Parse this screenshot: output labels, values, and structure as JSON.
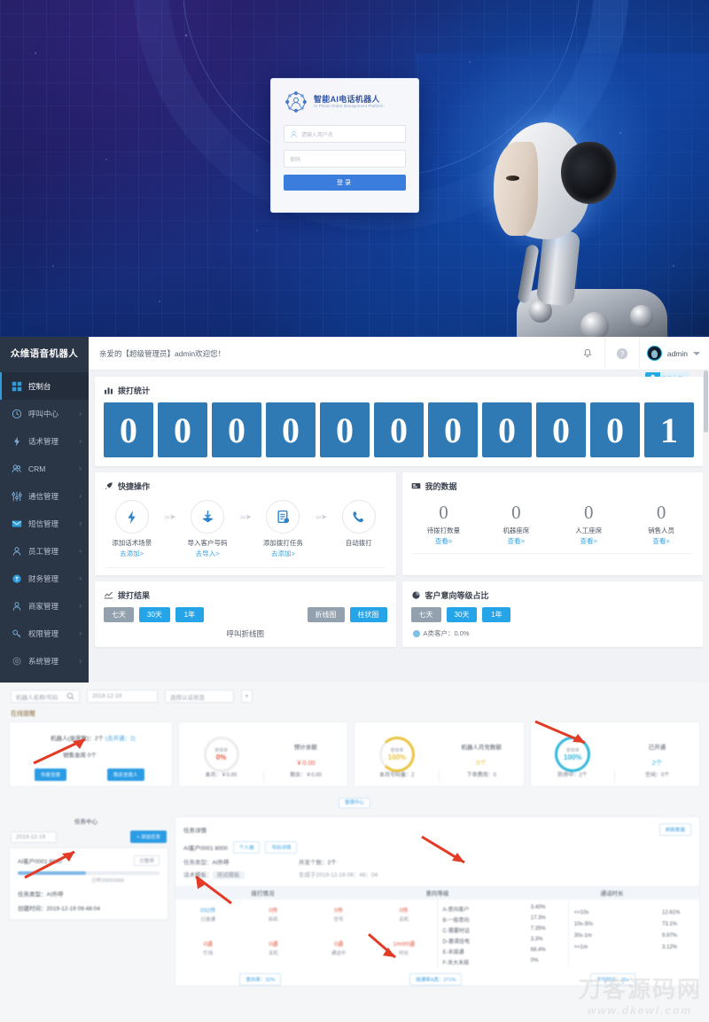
{
  "login": {
    "title_cn": "智能AI电话机器人",
    "title_en": "AI Phone Robot Management Platform",
    "username_placeholder": "请输入用户名",
    "password_placeholder": "密码",
    "submit_label": "登录"
  },
  "topbar": {
    "brand": "众维语音机器人",
    "welcome": "亲爱的【超级管理员】admin欢迎您！",
    "user": "admin",
    "upload_badge": "协议上传"
  },
  "sidebar": {
    "items": [
      {
        "label": "控制台",
        "icon": "dashboard-icon",
        "active": true,
        "arrow": ""
      },
      {
        "label": "呼叫中心",
        "icon": "clock-icon",
        "active": false,
        "arrow": "›"
      },
      {
        "label": "话术管理",
        "icon": "bolt-icon",
        "active": false,
        "arrow": "›"
      },
      {
        "label": "CRM",
        "icon": "users-icon",
        "active": false,
        "arrow": "›"
      },
      {
        "label": "通信管理",
        "icon": "sliders-icon",
        "active": false,
        "arrow": "›"
      },
      {
        "label": "短信管理",
        "icon": "mail-icon",
        "active": false,
        "arrow": "›"
      },
      {
        "label": "员工管理",
        "icon": "user-icon",
        "active": false,
        "arrow": "›"
      },
      {
        "label": "财务管理",
        "icon": "coin-icon",
        "active": false,
        "arrow": "›"
      },
      {
        "label": "商家管理",
        "icon": "user-icon",
        "active": false,
        "arrow": "›"
      },
      {
        "label": "权限管理",
        "icon": "key-icon",
        "active": false,
        "arrow": "›"
      },
      {
        "label": "系统管理",
        "icon": "gear-icon",
        "active": false,
        "arrow": "›"
      }
    ]
  },
  "call_stats": {
    "title": "拨打统计",
    "icon": "bar-chart-icon",
    "digits": [
      "0",
      "0",
      "0",
      "0",
      "0",
      "0",
      "0",
      "0",
      "0",
      "0",
      "1"
    ]
  },
  "quick_ops": {
    "title": "快捷操作",
    "icon": "rocket-icon",
    "steps": [
      {
        "icon": "bolt-icon",
        "label": "添加话术场景",
        "link": "去添加>"
      },
      {
        "icon": "import-icon",
        "label": "导入客户号码",
        "link": "去导入>"
      },
      {
        "icon": "doc-add-icon",
        "label": "添加拨打任务",
        "link": "去添加>"
      },
      {
        "icon": "phone-icon",
        "label": "自动拨打",
        "link": ""
      }
    ],
    "connector": "›››➤"
  },
  "my_data": {
    "title": "我的数据",
    "icon": "monitor-icon",
    "items": [
      {
        "value": "0",
        "label": "待拨打数量",
        "link": "查看>"
      },
      {
        "value": "0",
        "label": "机器座席",
        "link": "查看>"
      },
      {
        "value": "0",
        "label": "人工座席",
        "link": "查看>"
      },
      {
        "value": "0",
        "label": "销售人员",
        "link": "查看>"
      }
    ]
  },
  "call_result": {
    "title": "拨打结果",
    "icon": "line-chart-icon",
    "ranges": [
      {
        "label": "七天",
        "selected": false
      },
      {
        "label": "30天",
        "selected": true
      },
      {
        "label": "1年",
        "selected": true
      }
    ],
    "chart_types": [
      {
        "label": "折线图",
        "selected": false
      },
      {
        "label": "柱状图",
        "selected": true
      }
    ],
    "caption": "呼叫折线图"
  },
  "intent_ratio": {
    "title": "客户意向等级占比",
    "icon": "pie-chart-icon",
    "ranges": [
      {
        "label": "七天",
        "selected": false
      },
      {
        "label": "30天",
        "selected": true
      },
      {
        "label": "1年",
        "selected": true
      }
    ],
    "legend_first": "A类客户：0.0%"
  },
  "lower": {
    "filters": {
      "search_placeholder": "机器人名称/号码",
      "search_icon": "search-icon",
      "date_value": "2019-12-19",
      "status_placeholder": "选择认证状态",
      "chevron_icon": "chevron-down-icon"
    },
    "section_label": "在线提醒",
    "robot_card": {
      "line1_prefix": "机器人(坐席数)：",
      "line1_count": "2个",
      "line1_link": "(去开通：2)",
      "line2": "销售坐席 0个",
      "btn_left": "作废坐席",
      "btn_right": "购买坐席人"
    },
    "gauges": [
      {
        "label": "使用率",
        "value": "0%",
        "color": "#e2573f",
        "ring": "#efefef"
      },
      {
        "label": "使用率",
        "value": "100%",
        "color": "#e8c33c",
        "ring": "#e8c33c"
      },
      {
        "label": "使用率",
        "value": "100%",
        "color": "#2fb6d8",
        "ring": "#2fb6d8"
      }
    ],
    "money_cards": [
      {
        "label": "预计余额",
        "value": "￥0.00"
      },
      {
        "label": "机器人月充数额",
        "value": "0个"
      },
      {
        "label": "已开通",
        "value": "2个"
      }
    ],
    "foot_stats": [
      {
        "left": "本月：￥0.00",
        "right": "剩余：￥0.00"
      },
      {
        "left": "本月号码量：2",
        "right": "下单费用：0"
      },
      {
        "left": "防停中：2个",
        "right": "空闲：0个"
      }
    ],
    "pill": "管理中心",
    "task_center": {
      "title": "任务中心",
      "date": "2019-12-19",
      "add_btn": "+ 添加任务",
      "task_name": "AI客户0001 8000",
      "status_btn": "已暂停",
      "progress_text": "已呼2000/2000",
      "meta_type_label": "任务类型：",
      "meta_type_value": "AI外呼",
      "meta_time_label": "创建时间：",
      "meta_time_value": "2019-12-19 09:48:04"
    },
    "task_detail": {
      "title": "任务详情",
      "refresh_btn": "刷新数据",
      "task_name": "AI客户0001 8000",
      "btn1": "个人端",
      "btn2": "号码详情",
      "info": [
        {
          "label": "任务类型：",
          "value": "AI外呼"
        },
        {
          "label": "并发个数：",
          "value": "2个"
        },
        {
          "label": "话术模板：",
          "value": "测试模板"
        },
        {
          "label": "",
          "value": "生成于2019-12-19 09：48：04"
        }
      ],
      "col_headers": [
        "拨打情况",
        "意向等级",
        "通话时长"
      ],
      "cells": [
        {
          "value": "032件",
          "label": "已拨通",
          "accent": "blue"
        },
        {
          "value": "0件",
          "label": "拆机",
          "accent": "red"
        },
        {
          "value": "0件",
          "label": "空号",
          "accent": "red"
        },
        {
          "value": "0件",
          "label": "关机",
          "accent": "red"
        },
        {
          "value": "0通",
          "label": "忙线",
          "accent": "red"
        },
        {
          "value": "0通",
          "label": "关机",
          "accent": "red"
        },
        {
          "value": "0通",
          "label": "通话中",
          "accent": "red"
        },
        {
          "value": "1/m00通",
          "label": "时长",
          "accent": "red"
        }
      ],
      "intent_rows": [
        {
          "k": "A-意向客户",
          "v": "3.40%"
        },
        {
          "k": "B-一般意向",
          "v": "17.3%"
        },
        {
          "k": "C-需要时话",
          "v": "7.35%"
        },
        {
          "k": "D-邀请挂电",
          "v": "3.3%"
        },
        {
          "k": "E-未接通",
          "v": "68.4%"
        },
        {
          "k": "F-关大未接",
          "v": "0%"
        }
      ],
      "duration_rows": [
        {
          "k": "<=10s",
          "v": "12.61%"
        },
        {
          "k": "10s-30s",
          "v": "73.1%"
        },
        {
          "k": "30s-1m",
          "v": "9.97%"
        },
        {
          "k": ">=1m",
          "v": "3.12%"
        }
      ],
      "pills": [
        "意向率：32%",
        "接通率A类：271%",
        "平均时长：25s"
      ]
    }
  },
  "watermark": {
    "line1": "刀客源码网",
    "line2": "www.dkewl.com"
  }
}
